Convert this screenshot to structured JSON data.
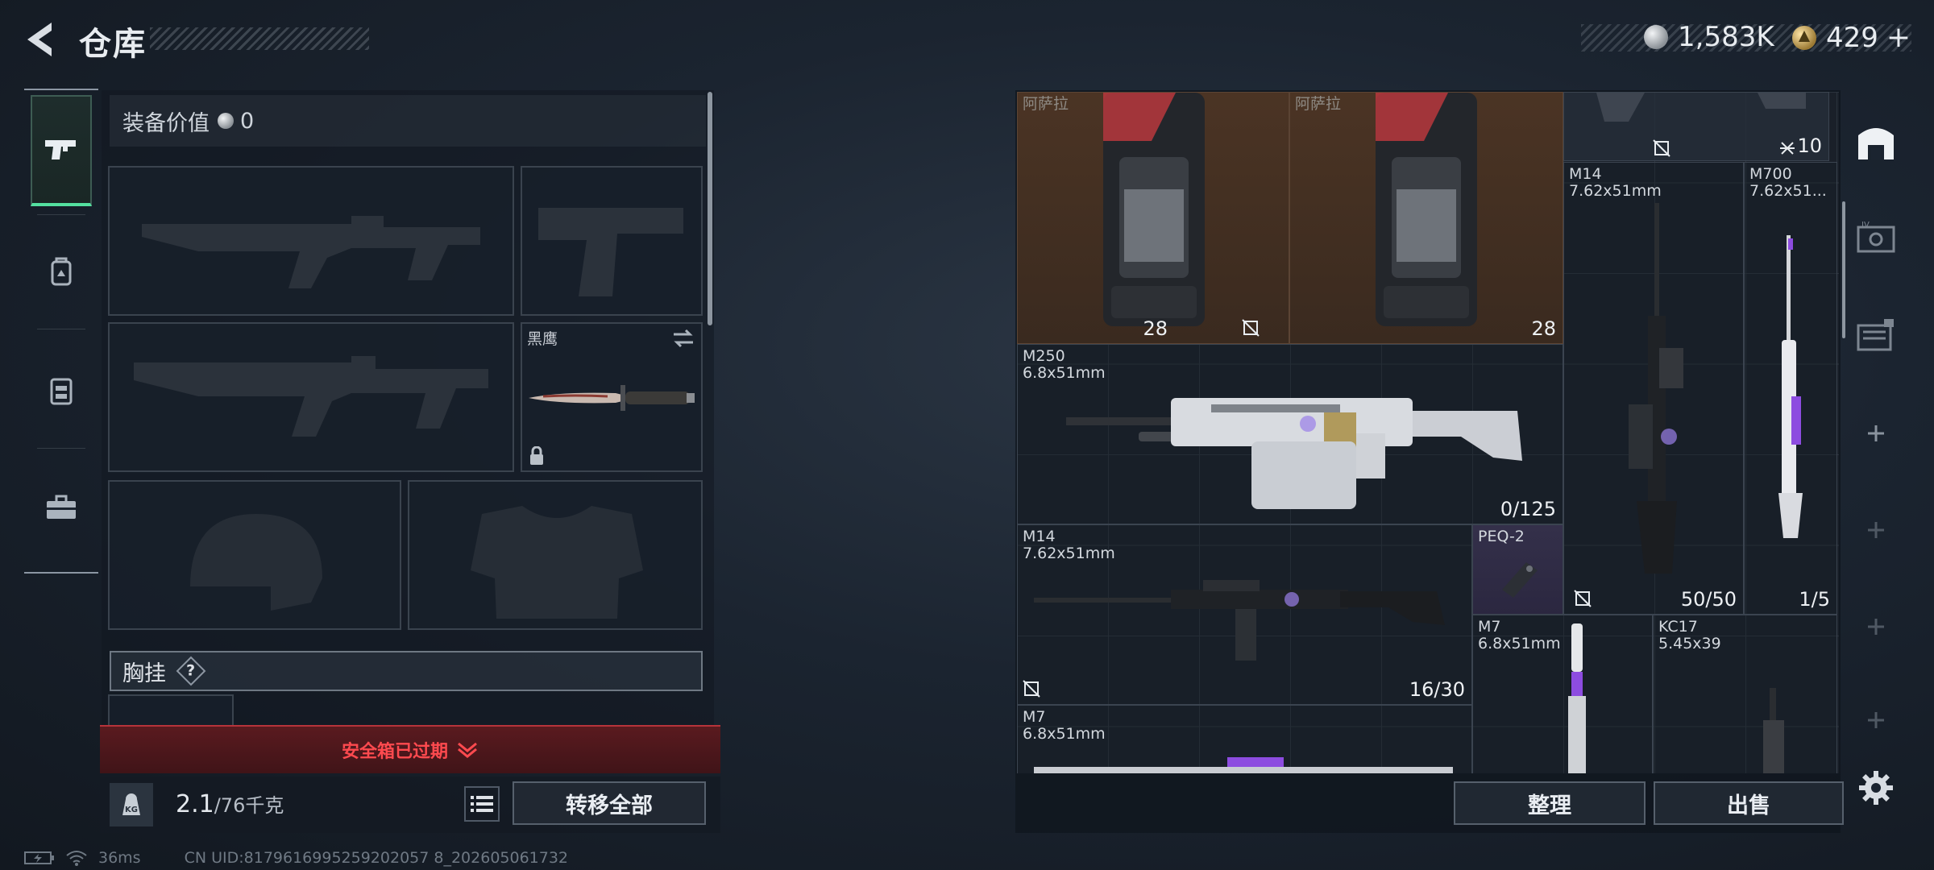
{
  "header": {
    "title": "仓库",
    "currencies": [
      {
        "icon": "silver-coin-icon",
        "value": "1,583K"
      },
      {
        "icon": "gold-triangle-coin-icon",
        "value": "429"
      }
    ],
    "add_label": "+"
  },
  "left_nav": {
    "items": [
      {
        "name": "weapons-tab",
        "icon": "pistol-icon",
        "active": true
      },
      {
        "name": "backpack-tab",
        "icon": "backpack-icon",
        "active": false
      },
      {
        "name": "chest-rig-tab",
        "icon": "rig-icon",
        "active": false
      },
      {
        "name": "case-tab",
        "icon": "toolbox-icon",
        "active": false
      }
    ]
  },
  "loadout": {
    "equip_value_label": "装备价值",
    "equip_value": "0",
    "knife_label": "黑鹰",
    "chest_label": "胸挂",
    "help_label": "?",
    "safe_box_expired": "安全箱已过期",
    "weight_current": "2.1",
    "weight_max": "/76千克",
    "transfer_all": "转移全部"
  },
  "inventory": {
    "items": [
      {
        "key": "bp1",
        "name": "阿萨拉",
        "count": "28"
      },
      {
        "key": "bp2",
        "name": "阿萨拉",
        "count": "28"
      },
      {
        "key": "top-right",
        "count": "10"
      },
      {
        "key": "m14a",
        "name": "M14\n7.62x51mm"
      },
      {
        "key": "m700",
        "name": "M700\n7.62x51...",
        "count": "1/5"
      },
      {
        "key": "m250",
        "name": "M250\n6.8x51mm",
        "count": "0/125"
      },
      {
        "key": "m14b",
        "name": "M14\n7.62x51mm",
        "count": "16/30"
      },
      {
        "key": "peq",
        "name": "PEQ-2"
      },
      {
        "key": "m14a-count",
        "count": "50/50"
      },
      {
        "key": "m7a",
        "name": "M7\n6.8x51mm"
      },
      {
        "key": "kc17",
        "name": "KC17\n5.45x39"
      },
      {
        "key": "m7b",
        "name": "M7\n6.8x51mm"
      }
    ],
    "sort_label": "整理",
    "sell_label": "出售"
  },
  "status": {
    "ping": "36ms",
    "uid": "CN UID:8179616995259202057 8_202605061732"
  },
  "colors": {
    "active_green": "#54e0a0",
    "alert_red": "#ff4a4f",
    "orange_item_bg": "#4b3424",
    "purple_accent": "#8d4ce0"
  }
}
